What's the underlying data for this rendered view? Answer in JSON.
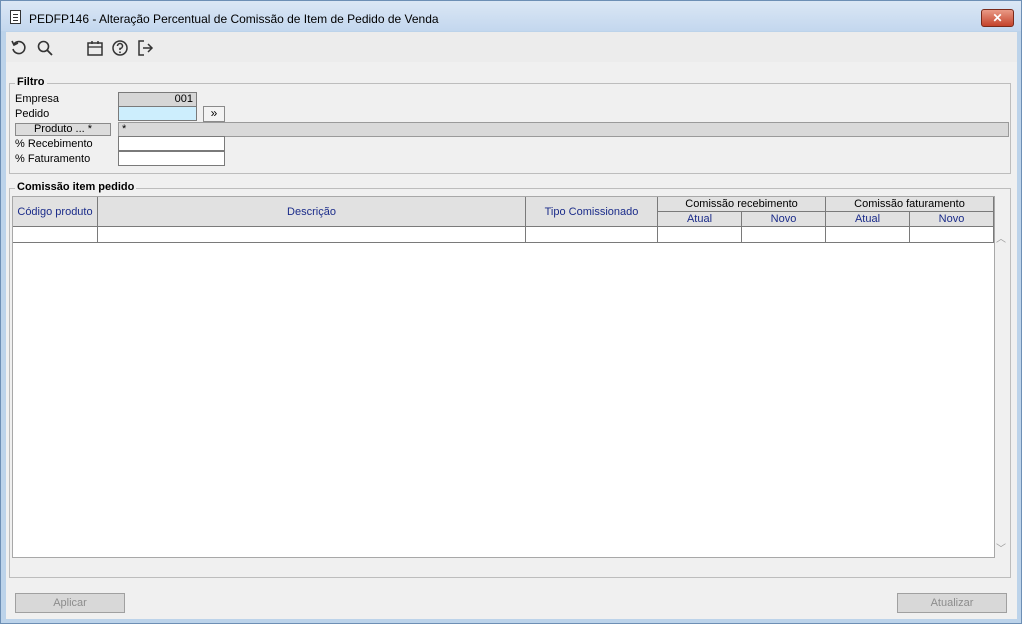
{
  "window": {
    "title": "PEDFP146 - Alteração Percentual de Comissão de Item de Pedido de Venda",
    "close_label": "✕"
  },
  "toolbar": {
    "icons": [
      "undo-icon",
      "search-icon",
      "calendar-icon",
      "help-icon",
      "exit-icon"
    ]
  },
  "filter": {
    "title": "Filtro",
    "empresa_label": "Empresa",
    "empresa_value": "001",
    "pedido_label": "Pedido",
    "pedido_value": "",
    "pedido_button": "»",
    "produto_label": "Produto ... *",
    "produto_value": "*",
    "recebimento_label": "% Recebimento",
    "recebimento_value": "",
    "faturamento_label": "% Faturamento",
    "faturamento_value": ""
  },
  "grid": {
    "title": "Comissão item pedido",
    "columns": {
      "codigo": "Código produto",
      "descricao": "Descrição",
      "tipo": "Tipo Comissionado",
      "recebimento": "Comissão recebimento",
      "faturamento": "Comissão faturamento",
      "atual": "Atual",
      "novo": "Novo"
    },
    "rows": []
  },
  "footer": {
    "aplicar": "Aplicar",
    "atualizar": "Atualizar"
  },
  "colors": {
    "header_text": "#1b2c8a",
    "pedido_field": "#cdeefd"
  }
}
